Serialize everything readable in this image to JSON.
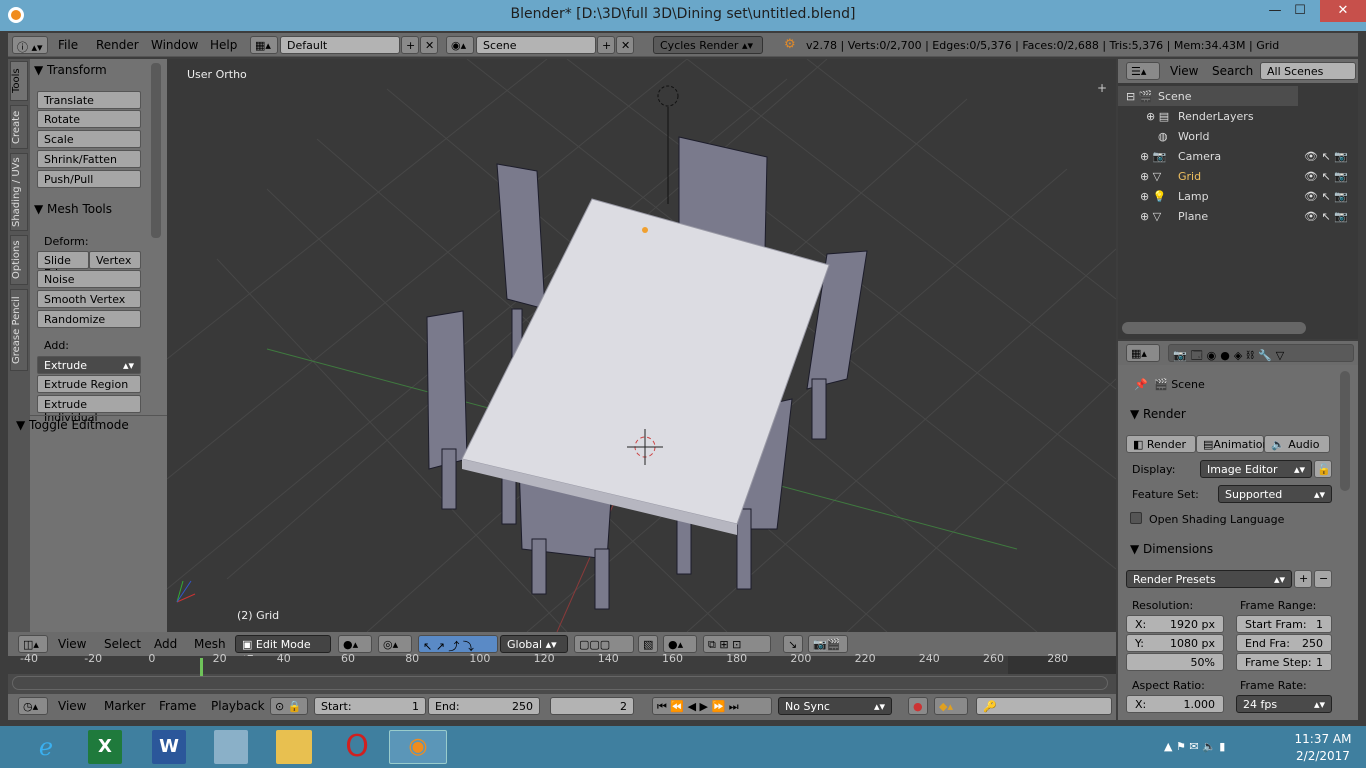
{
  "window": {
    "title": "Blender* [D:\\3D\\full 3D\\Dining set\\untitled.blend]",
    "min": "—",
    "max": "☐",
    "close": "✕"
  },
  "infobar": {
    "menus": [
      "File",
      "Render",
      "Window",
      "Help"
    ],
    "layout": "Default",
    "scene": "Scene",
    "engine": "Cycles Render",
    "stats": "v2.78 | Verts:0/2,700 | Edges:0/5,376 | Faces:0/2,688 | Tris:5,376 | Mem:34.43M | Grid"
  },
  "tools_tabs": [
    "Tools",
    "Create",
    "Shading / UVs",
    "Options",
    "Grease Pencil"
  ],
  "toolshelf": {
    "transform_title": "Transform",
    "transform_buttons": [
      "Translate",
      "Rotate",
      "Scale",
      "Shrink/Fatten",
      "Push/Pull"
    ],
    "mesh_tools_title": "Mesh Tools",
    "deform_label": "Deform:",
    "slide_edge": "Slide Ed",
    "vertex": "Vertex",
    "deform_buttons": [
      "Noise",
      "Smooth Vertex",
      "Randomize"
    ],
    "add_label": "Add:",
    "extrude": "Extrude",
    "add_buttons": [
      "Extrude Region",
      "Extrude Individual"
    ],
    "toggle_editmode": "Toggle Editmode"
  },
  "viewport": {
    "view_label": "User Ortho",
    "object_label": "(2) Grid"
  },
  "view3d_header": {
    "menus": [
      "View",
      "Select",
      "Add",
      "Mesh"
    ],
    "mode": "Edit Mode",
    "orientation": "Global"
  },
  "timeline": {
    "ticks": [
      "-40",
      "-20",
      "0",
      "20",
      "40",
      "60",
      "80",
      "100",
      "120",
      "140",
      "160",
      "180",
      "200",
      "220",
      "240",
      "260",
      "280"
    ],
    "menus": [
      "View",
      "Marker",
      "Frame",
      "Playback"
    ],
    "start_label": "Start:",
    "start": "1",
    "end_label": "End:",
    "end": "250",
    "current": "2",
    "sync": "No Sync"
  },
  "outliner": {
    "menus": [
      "View",
      "Search"
    ],
    "filter": "All Scenes",
    "items": [
      {
        "name": "Scene",
        "level": 0
      },
      {
        "name": "RenderLayers",
        "level": 1
      },
      {
        "name": "World",
        "level": 1
      },
      {
        "name": "Camera",
        "level": 1
      },
      {
        "name": "Grid",
        "level": 1
      },
      {
        "name": "Lamp",
        "level": 1
      },
      {
        "name": "Plane",
        "level": 1
      }
    ]
  },
  "properties": {
    "context": "Scene",
    "render_title": "Render",
    "render_btn": "Render",
    "animation_btn": "Animation",
    "audio_btn": "Audio",
    "display_label": "Display:",
    "display_value": "Image Editor",
    "feature_label": "Feature Set:",
    "feature_value": "Supported",
    "osl_label": "Open Shading Language",
    "dimensions_title": "Dimensions",
    "presets": "Render Presets",
    "resolution_label": "Resolution:",
    "res_x": "X:",
    "res_x_val": "1920 px",
    "res_y": "Y:",
    "res_y_val": "1080 px",
    "res_pct": "50%",
    "frame_range_label": "Frame Range:",
    "start_frame": "Start Fram:",
    "start_frame_val": "1",
    "end_frame": "End Fra:",
    "end_frame_val": "250",
    "frame_step": "Frame Step:",
    "frame_step_val": "1",
    "aspect_label": "Aspect Ratio:",
    "aspect_x": "X:",
    "aspect_x_val": "1.000",
    "frame_rate_label": "Frame Rate:",
    "frame_rate": "24 fps"
  },
  "taskbar": {
    "time": "11:37 AM",
    "date": "2/2/2017"
  }
}
